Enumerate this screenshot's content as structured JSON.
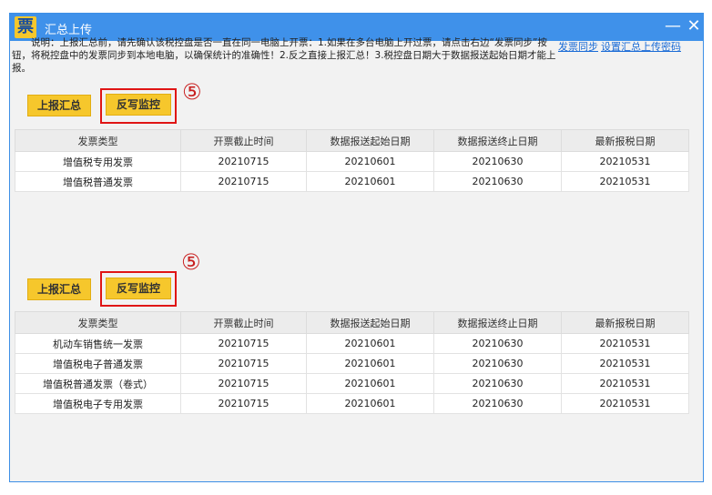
{
  "window": {
    "title": "汇总上传",
    "icon_glyph": "票",
    "minimize_glyph": "—",
    "close_glyph": "✕"
  },
  "notice": {
    "line1": "说明：上报汇总前，请先确认该税控盘是否一直在同一电脑上开票：1.如果在多台电脑上开过票，请点击右边“发票同",
    "line2": "步”按钮，将税控盘中的发票同步到本地电脑，以确保统计的准确性！2.反之直接上报汇总！3.税控盘日期大于数据报送起",
    "line3": "始日期才能上报。"
  },
  "links": {
    "sync": "发票同步",
    "set_password": "设置汇总上传密码"
  },
  "section1": {
    "report_button": "上报汇总",
    "writeback_button": "反写监控",
    "step_marker": "⑤",
    "headers": [
      "发票类型",
      "开票截止时间",
      "数据报送起始日期",
      "数据报送终止日期",
      "最新报税日期"
    ],
    "rows": [
      [
        "增值税专用发票",
        "20210715",
        "20210601",
        "20210630",
        "20210531"
      ],
      [
        "增值税普通发票",
        "20210715",
        "20210601",
        "20210630",
        "20210531"
      ]
    ]
  },
  "section2": {
    "report_button": "上报汇总",
    "writeback_button": "反写监控",
    "step_marker": "⑤",
    "headers": [
      "发票类型",
      "开票截止时间",
      "数据报送起始日期",
      "数据报送终止日期",
      "最新报税日期"
    ],
    "rows": [
      [
        "机动车销售统一发票",
        "20210715",
        "20210601",
        "20210630",
        "20210531"
      ],
      [
        "增值税电子普通发票",
        "20210715",
        "20210601",
        "20210630",
        "20210531"
      ],
      [
        "增值税普通发票（卷式）",
        "20210715",
        "20210601",
        "20210630",
        "20210531"
      ],
      [
        "增值税电子专用发票",
        "20210715",
        "20210601",
        "20210630",
        "20210531"
      ]
    ]
  },
  "colors": {
    "titlebar": "#3f91ea",
    "button_fill": "#f6c72c",
    "highlight_red": "#e01515",
    "link": "#1a6bd6"
  }
}
